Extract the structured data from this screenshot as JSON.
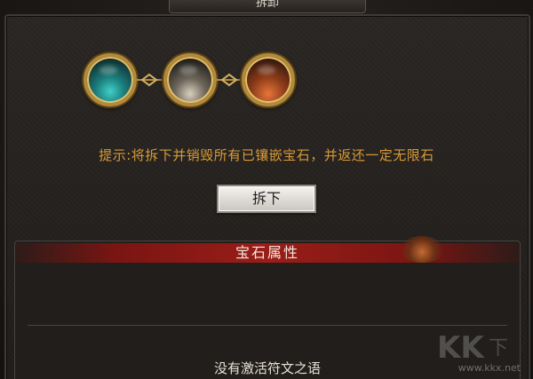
{
  "window": {
    "title": "拆卸"
  },
  "sockets": [
    {
      "name": "teal-gem",
      "color": "#2aa7a3"
    },
    {
      "name": "white-gem",
      "color": "#9a9080"
    },
    {
      "name": "orange-gem",
      "color": "#c4582a"
    }
  ],
  "hint": {
    "text": "提示:将拆下并销毁所有已镶嵌宝石，并返还一定无限石"
  },
  "actions": {
    "remove_label": "拆下"
  },
  "attributes": {
    "header": "宝石属性",
    "empty_text": "没有激活符文之语"
  },
  "watermark": {
    "url": "www.kkx.net"
  },
  "colors": {
    "hint": "#d89a36",
    "header_red": "#9a1d18",
    "gold_frame": "#b08a3c"
  }
}
